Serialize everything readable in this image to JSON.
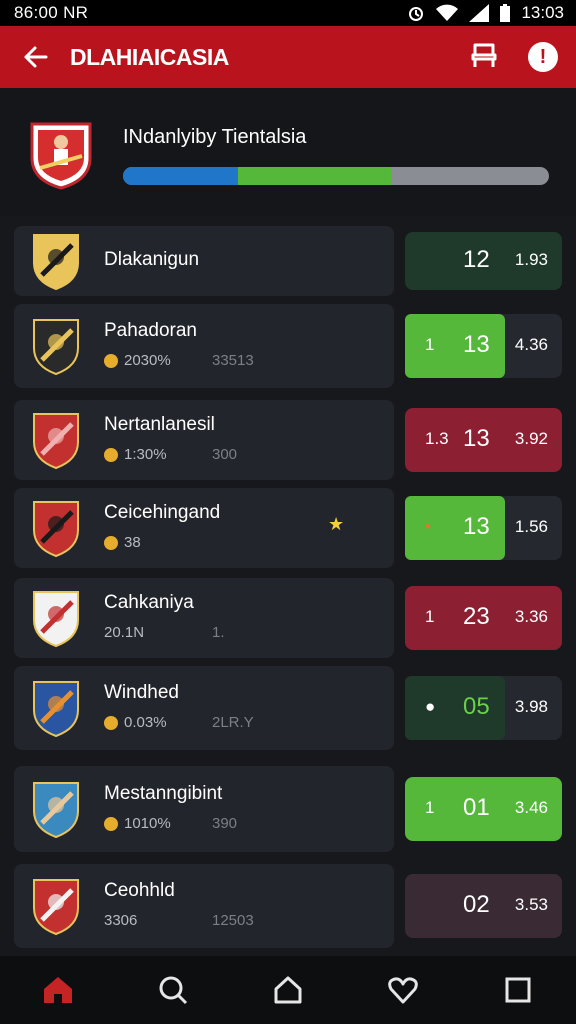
{
  "status": {
    "left_time": "86:00 NR",
    "clock": "13:03"
  },
  "app_bar": {
    "title": "DLAHIAICASIA"
  },
  "header": {
    "title": "INdanlyiby Tientalsia",
    "progress_segments": [
      0.27,
      0.36,
      0.37
    ]
  },
  "colors": {
    "app_bar": "#b9131d",
    "green": "#55b83b",
    "red": "#8c1f32",
    "blue": "#2076c9"
  },
  "rows": [
    {
      "name": "Dlakanigun",
      "meta1": "",
      "meta2": "",
      "pre": "",
      "score": "12",
      "odds": "1.93",
      "box": "dark-green",
      "inner": false
    },
    {
      "name": "Pahadoran",
      "meta1": "2030%",
      "meta2": "33513",
      "pre": "1",
      "score": "13",
      "odds": "4.36",
      "box": "dark",
      "inner": "green"
    },
    {
      "name": "Nertanlanesil",
      "meta1": "1:30%",
      "meta2": "300",
      "pre": "1.3",
      "score": "13",
      "odds": "3.92",
      "box": "red",
      "inner": false
    },
    {
      "name": "Ceicehingand",
      "meta1": "38",
      "meta2": "",
      "pre": "•",
      "score": "13",
      "odds": "1.56",
      "box": "dark",
      "inner": "green"
    },
    {
      "name": "Cahkaniya",
      "meta1": "20.1N",
      "meta2": "1.",
      "pre": "1",
      "score": "23",
      "odds": "3.36",
      "box": "red",
      "inner": false
    },
    {
      "name": "Windhed",
      "meta1": "0.03%",
      "meta2": "2LR.Y",
      "pre": "●",
      "score": "05",
      "odds": "3.98",
      "box": "dark",
      "inner": "dark-green"
    },
    {
      "name": "Mestanngibint",
      "meta1": "1010%",
      "meta2": "390",
      "pre": "1",
      "score": "01",
      "odds": "3.46",
      "box": "green",
      "inner": false
    },
    {
      "name": "Ceohhld",
      "meta1": "3306",
      "meta2": "12503",
      "pre": "",
      "score": "02",
      "odds": "3.53",
      "box": "plum",
      "inner": false
    }
  ],
  "nav": [
    "home-icon",
    "search-icon",
    "house-icon",
    "heart-icon",
    "square-icon"
  ]
}
